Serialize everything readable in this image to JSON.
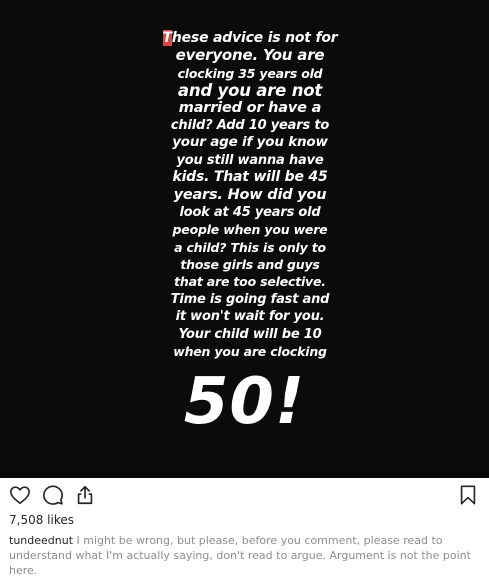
{
  "post": {
    "story_lines": [
      {
        "size": 14,
        "text": "These advice is not for"
      },
      {
        "size": 15,
        "text": "everyone. You are"
      },
      {
        "size": 12.5,
        "text": "clocking 35 years old"
      },
      {
        "size": 16.5,
        "text": "and you are not"
      },
      {
        "size": 14.5,
        "text": "married or have a"
      },
      {
        "size": 13,
        "text": "child? Add 10 years to"
      },
      {
        "size": 13.5,
        "text": "your age if you know"
      },
      {
        "size": 13,
        "text": "you still wanna have"
      },
      {
        "size": 14,
        "text": "kids. That will be 45"
      },
      {
        "size": 14.5,
        "text": "years. How did you"
      },
      {
        "size": 13,
        "text": "look at 45 years old"
      },
      {
        "size": 12.5,
        "text": "people when you were"
      },
      {
        "size": 12.5,
        "text": "a child? This is only to"
      },
      {
        "size": 12.5,
        "text": "those girls and guys"
      },
      {
        "size": 12.5,
        "text": "that are too selective."
      },
      {
        "size": 13,
        "text": "Time is going fast and"
      },
      {
        "size": 13,
        "text": "it won't wait for you."
      },
      {
        "size": 13,
        "text": "Your child will be 10"
      },
      {
        "size": 12.5,
        "text": "when you are clocking"
      }
    ],
    "first_line_rest": "hese advice is not for",
    "first_line_letter": "T",
    "big_number": "50!"
  },
  "actions": {
    "like_icon": "heart-icon",
    "comment_icon": "comment-icon",
    "share_icon": "share-icon",
    "save_icon": "bookmark-icon"
  },
  "likes": "7,508 likes",
  "caption": {
    "username": "tundeednut",
    "text": "I might be wrong, but please, before you comment, please read to understand what I'm actually saying, don't read to argue. Argument is not the point here."
  },
  "colors": {
    "image_background": "#0b0b0b",
    "cursor_highlight": "#e3413b",
    "text_primary": "#262626",
    "text_secondary": "#8e8e8e"
  }
}
